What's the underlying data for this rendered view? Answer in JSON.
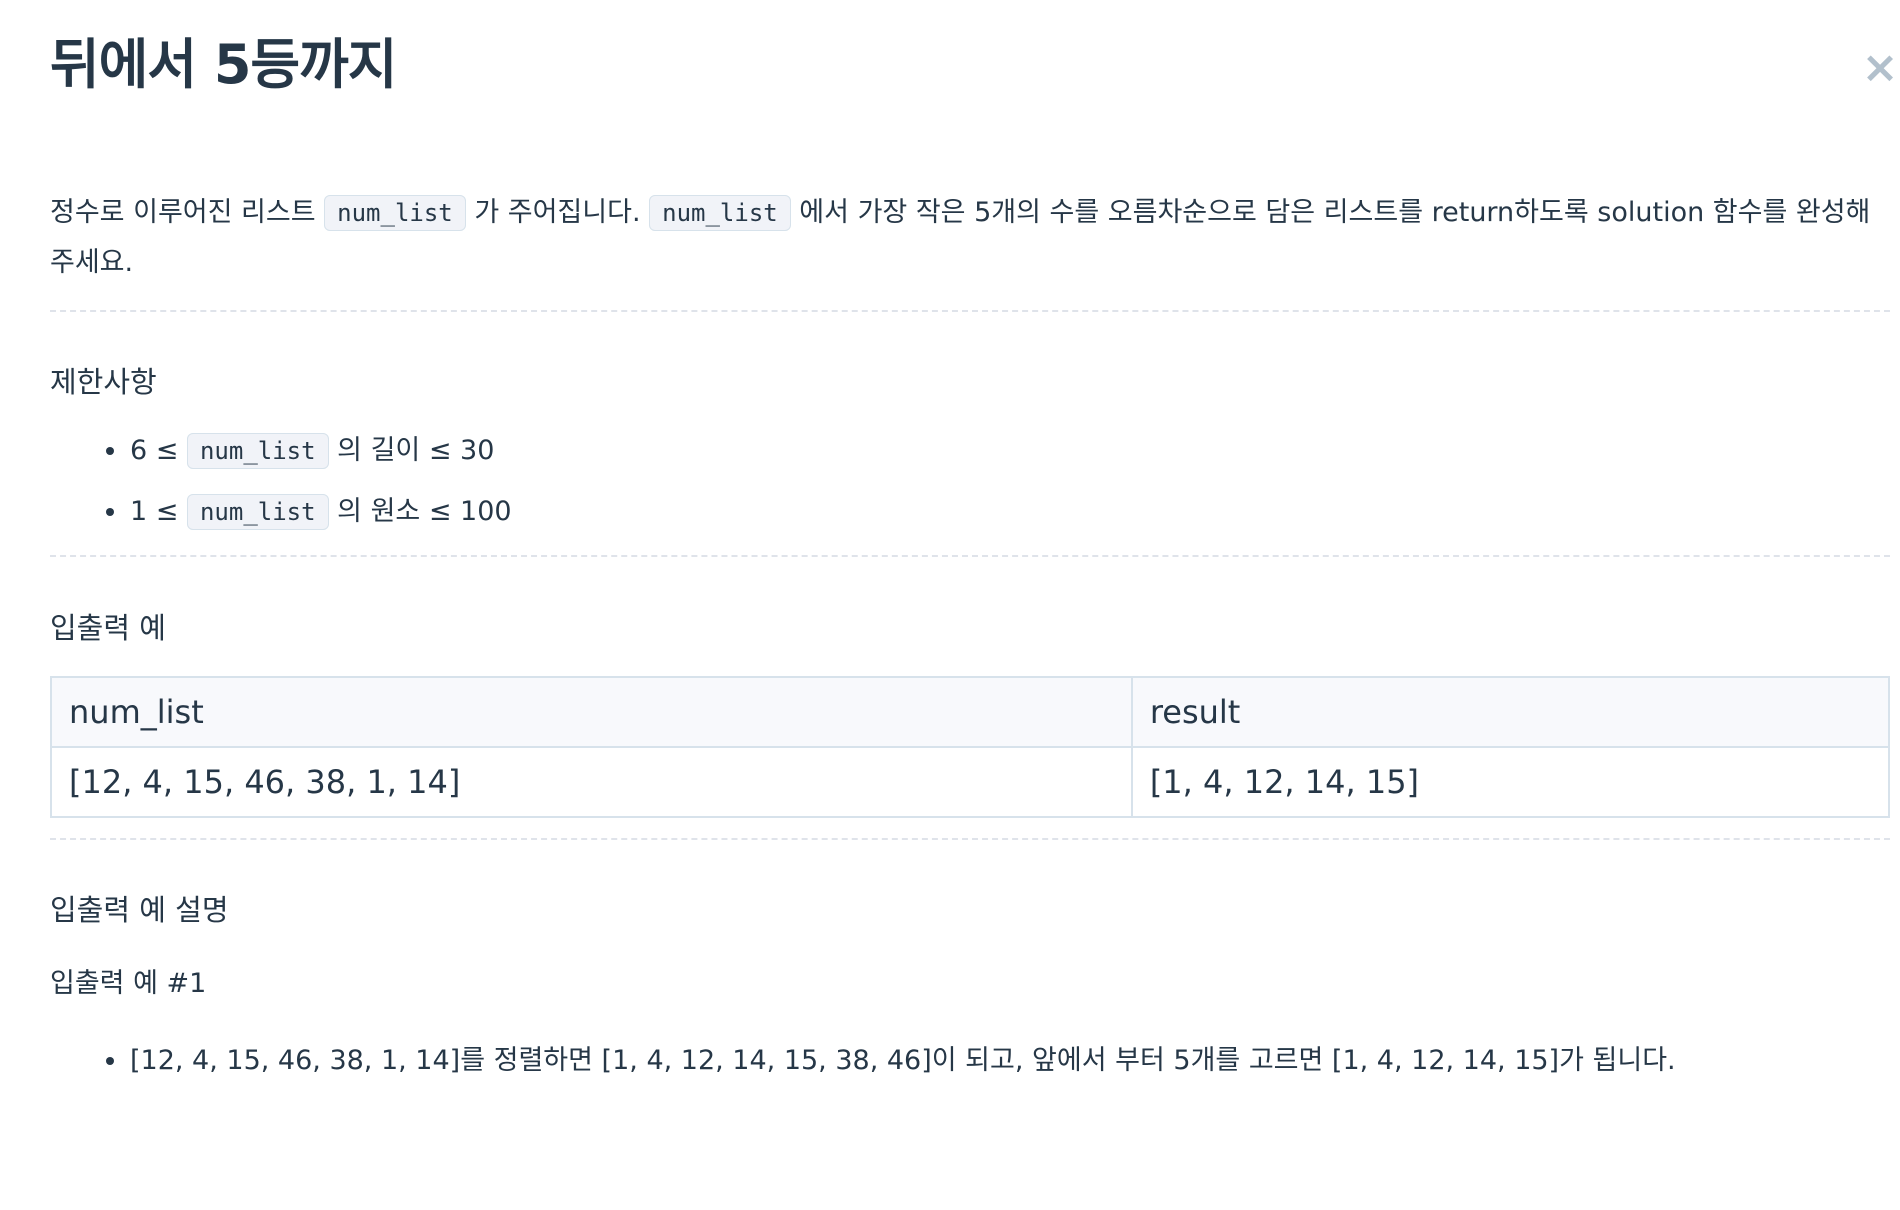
{
  "title": "뒤에서 5등까지",
  "close_label": "×",
  "description": {
    "part1": "정수로 이루어진 리스트 ",
    "code1": "num_list",
    "part2": " 가 주어집니다. ",
    "code2": "num_list",
    "part3": " 에서 가장 작은 5개의 수를 오름차순으로 담은 리스트를 return하도록 solution 함수를 완성해주세요."
  },
  "constraints": {
    "heading": "제한사항",
    "items": [
      {
        "prefix": "6 ≤ ",
        "code": "num_list",
        "suffix": " 의 길이 ≤ 30"
      },
      {
        "prefix": "1 ≤ ",
        "code": "num_list",
        "suffix": " 의 원소 ≤ 100"
      }
    ]
  },
  "examples": {
    "heading": "입출력 예",
    "columns": [
      "num_list",
      "result"
    ],
    "rows": [
      [
        "[12, 4, 15, 46, 38, 1, 14]",
        "[1, 4, 12, 14, 15]"
      ]
    ]
  },
  "explanation": {
    "heading": "입출력 예 설명",
    "subheading": "입출력 예 #1",
    "items": [
      "[12, 4, 15, 46, 38, 1, 14]를 정렬하면 [1, 4, 12, 14, 15, 38, 46]이 되고, 앞에서 부터 5개를 고르면 [1, 4, 12, 14, 15]가 됩니다."
    ]
  }
}
